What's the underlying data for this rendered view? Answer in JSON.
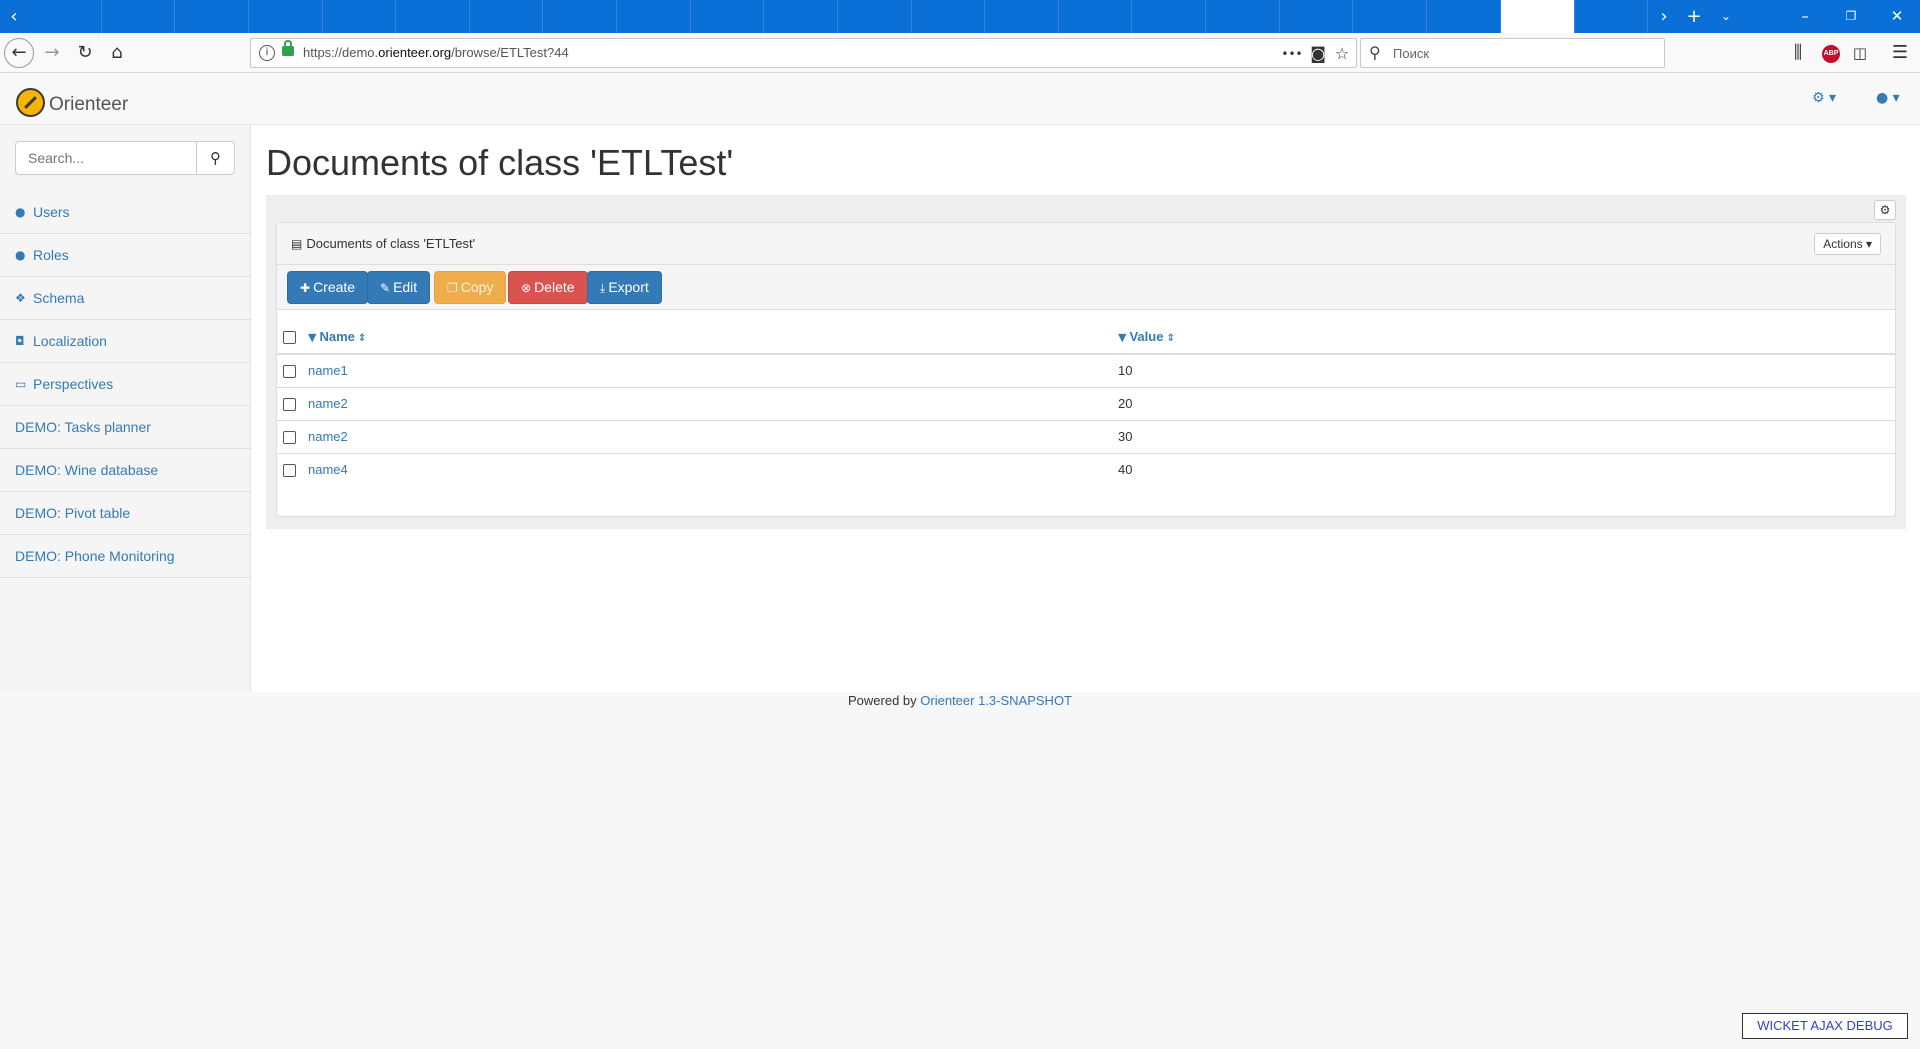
{
  "browser": {
    "url_prefix": "https://demo.",
    "url_domain": "orienteer.org",
    "url_path": "/browse/ETLTest?44",
    "search_placeholder": "Поиск",
    "page_actions_label": "•••",
    "abp_label": "ABP"
  },
  "app": {
    "brand": "Orienteer",
    "search_placeholder": "Search...",
    "nav": [
      {
        "label": "Users",
        "icon": "users-icon"
      },
      {
        "label": "Roles",
        "icon": "users-icon"
      },
      {
        "label": "Schema",
        "icon": "cubes-icon"
      },
      {
        "label": "Localization",
        "icon": "language-icon"
      },
      {
        "label": "Perspectives",
        "icon": "desktop-icon"
      },
      {
        "label": "DEMO: Tasks planner",
        "icon": ""
      },
      {
        "label": "DEMO: Wine database",
        "icon": ""
      },
      {
        "label": "DEMO: Pivot table",
        "icon": ""
      },
      {
        "label": "DEMO: Phone Monitoring",
        "icon": ""
      }
    ]
  },
  "main": {
    "title": "Documents of class 'ETLTest'",
    "panel_title": "Documents of class 'ETLTest'",
    "actions_label": "Actions",
    "buttons": {
      "create": "Create",
      "edit": "Edit",
      "copy": "Copy",
      "delete": "Delete",
      "export": "Export"
    },
    "table": {
      "columns": [
        "Name",
        "Value"
      ],
      "rows": [
        {
          "name": "name1",
          "value": "10"
        },
        {
          "name": "name2",
          "value": "20"
        },
        {
          "name": "name2",
          "value": "30"
        },
        {
          "name": "name4",
          "value": "40"
        }
      ]
    }
  },
  "footer": {
    "prefix": "Powered by",
    "link": "Orienteer 1.3-SNAPSHOT"
  },
  "debug_button": "WICKET AJAX DEBUG",
  "colors": {
    "primary": "#337ab7",
    "warning": "#f0ad4e",
    "danger": "#d9534f",
    "tabstrip": "#0a6fd6"
  }
}
